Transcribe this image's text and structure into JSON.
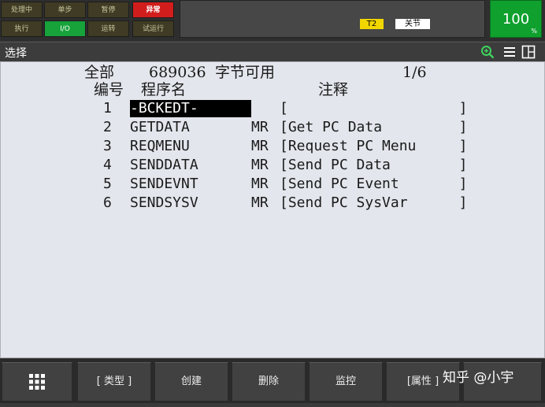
{
  "status": {
    "leds": [
      {
        "label": "处理中",
        "state": "off"
      },
      {
        "label": "单步",
        "state": "off"
      },
      {
        "label": "暂停",
        "state": "off"
      },
      {
        "label": "异常",
        "state": "red"
      },
      {
        "label": "执行",
        "state": "off"
      },
      {
        "label": "I/O",
        "state": "green"
      },
      {
        "label": "运转",
        "state": "off"
      },
      {
        "label": "试运行",
        "state": "off"
      }
    ],
    "mode": "T2",
    "coord": "关节",
    "override": "100",
    "override_mark": "%"
  },
  "titlebar": {
    "title": "选择",
    "icons": [
      "zoom-in-icon",
      "menu-icon",
      "split-window-icon"
    ]
  },
  "listing": {
    "header_label": "全部",
    "bytes_free": "689036",
    "bytes_label": "字节可用",
    "page": "1/6",
    "col_number": "编号",
    "col_name": "程序名",
    "col_comment": "注释",
    "programs": [
      {
        "no": "1",
        "name": "-BCKEDT-",
        "type": "",
        "comment": "[                    ]"
      },
      {
        "no": "2",
        "name": "GETDATA",
        "type": "MR",
        "comment": "[Get PC Data         ]"
      },
      {
        "no": "3",
        "name": "REQMENU",
        "type": "MR",
        "comment": "[Request PC Menu     ]"
      },
      {
        "no": "4",
        "name": "SENDDATA",
        "type": "MR",
        "comment": "[Send PC Data        ]"
      },
      {
        "no": "5",
        "name": "SENDEVNT",
        "type": "MR",
        "comment": "[Send PC Event       ]"
      },
      {
        "no": "6",
        "name": "SENDSYSV",
        "type": "MR",
        "comment": "[Send PC SysVar      ]"
      }
    ],
    "selected_index": 0
  },
  "fkeys": {
    "f1": "[ 类型 ]",
    "f2": "创建",
    "f3": "删除",
    "f4": "监控",
    "f5": "[属性 ]"
  },
  "watermark": "知乎 @小宇",
  "colors": {
    "led_red": "#d21d1d",
    "led_green": "#17a23a",
    "mode_badge": "#f2d600",
    "override": "#0fa02e",
    "screen_bg": "#e3e6ec"
  }
}
